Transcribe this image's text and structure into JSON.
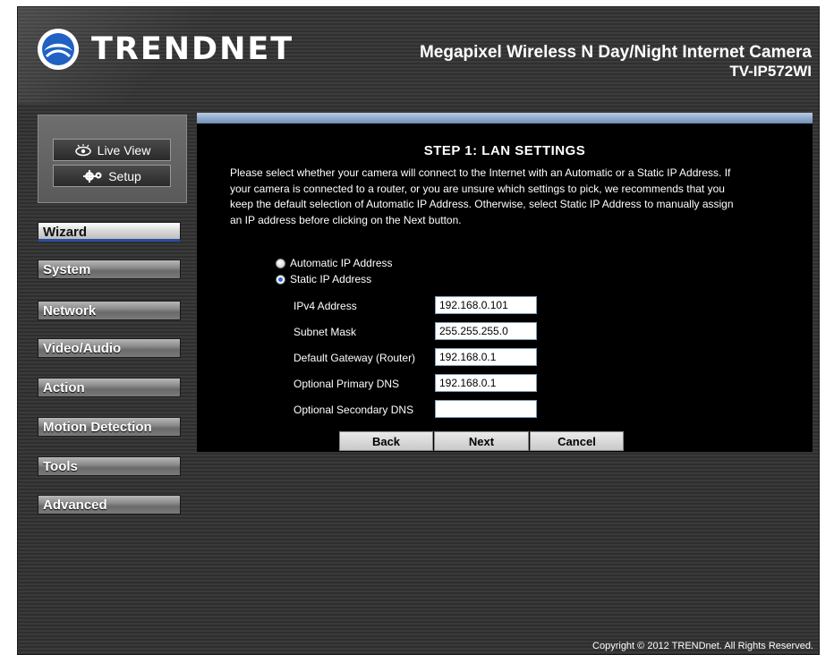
{
  "header": {
    "brand": "TRENDNET",
    "product_title": "Megapixel Wireless N Day/Night Internet Camera",
    "model": "TV-IP572WI"
  },
  "view_buttons": {
    "live_view": "Live View",
    "setup": "Setup"
  },
  "nav": {
    "items": [
      {
        "label": "Wizard",
        "active": true
      },
      {
        "label": "System",
        "active": false
      },
      {
        "label": "Network",
        "active": false
      },
      {
        "label": "Video/Audio",
        "active": false
      },
      {
        "label": "Action",
        "active": false
      },
      {
        "label": "Motion Detection",
        "active": false
      },
      {
        "label": "Tools",
        "active": false
      },
      {
        "label": "Advanced",
        "active": false
      }
    ]
  },
  "content": {
    "title": "STEP 1: LAN SETTINGS",
    "description_lines": [
      "Please select whether your camera will connect to the Internet with an Automatic or a Static IP Address. If",
      "your camera is connected to a router, or you are unsure which settings to pick, we recommends that you",
      "keep the default selection of Automatic IP Address. Otherwise, select Static IP Address to manually assign",
      "an IP address before clicking on the Next button."
    ],
    "radio_options": [
      {
        "label": "Automatic IP Address",
        "selected": false
      },
      {
        "label": "Static IP Address",
        "selected": true
      }
    ],
    "fields": [
      {
        "label": "IPv4 Address",
        "value": "192.168.0.101"
      },
      {
        "label": "Subnet Mask",
        "value": "255.255.255.0"
      },
      {
        "label": "Default Gateway (Router)",
        "value": "192.168.0.1"
      },
      {
        "label": "Optional Primary DNS",
        "value": "192.168.0.1"
      },
      {
        "label": "Optional Secondary DNS",
        "value": ""
      }
    ],
    "buttons": {
      "back": "Back",
      "next": "Next",
      "cancel": "Cancel"
    }
  },
  "footer": {
    "copyright": "Copyright © 2012 TRENDnet. All Rights Reserved."
  },
  "colors": {
    "accent_blue": "#2a4fa0",
    "content_bar": "#8aa6c8",
    "background": "#333333"
  }
}
